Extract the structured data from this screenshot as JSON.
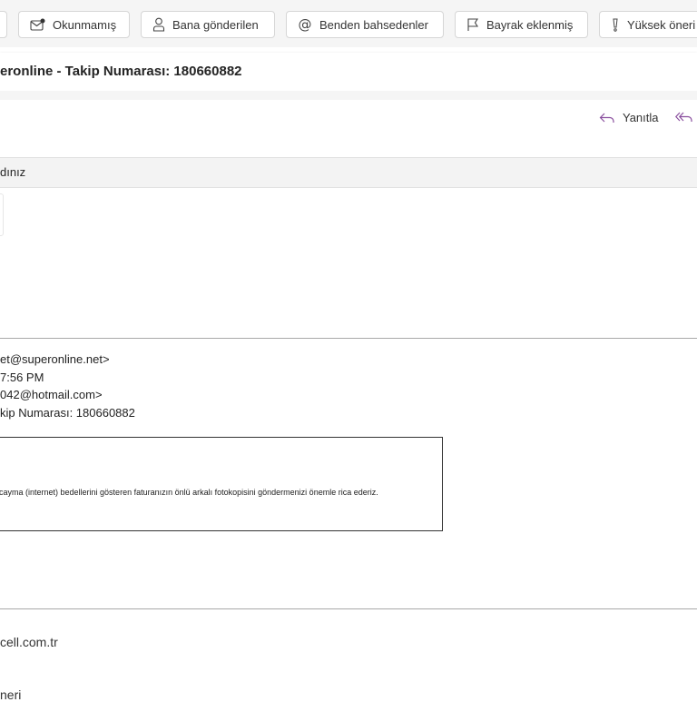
{
  "filters": [
    {
      "label": "Okunmamış",
      "icon": "envelope-dot-icon"
    },
    {
      "label": "Bana gönderilen",
      "icon": "person-icon"
    },
    {
      "label": "Benden bahsedenler",
      "icon": "at-icon"
    },
    {
      "label": "Bayrak eklenmiş",
      "icon": "flag-icon"
    },
    {
      "label": "Yüksek öneri",
      "icon": "exclamation-icon"
    }
  ],
  "subject": "eronline - Takip Numarası: 180660882",
  "actions": {
    "reply": "Yanıtla",
    "accent": "#8a4f9e"
  },
  "info_bar": "dınız",
  "forwarded_header": [
    "et@superonline.net>",
    "7:56 PM",
    "042@hotmail.com>",
    "kip Numarası: 180660882"
  ],
  "notice_text": "cayma (internet) bedellerini gösteren faturanızın önlü arkalı fotokopisini göndermenizi önemle rica ederiz.",
  "signature": [
    "cell.com.tr",
    "neri"
  ]
}
